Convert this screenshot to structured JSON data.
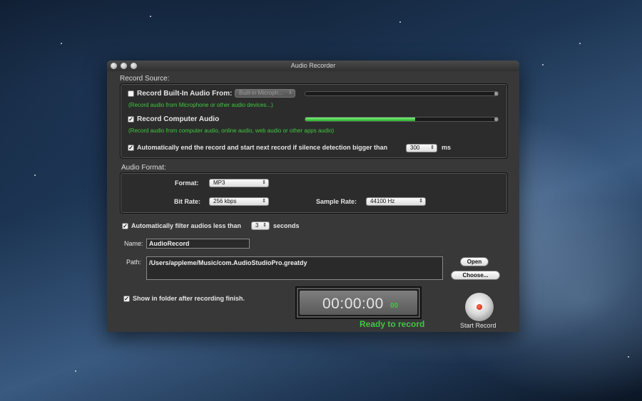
{
  "window": {
    "title": "Audio Recorder"
  },
  "record_source": {
    "label": "Record Source:",
    "builtin": {
      "checked": false,
      "label": "Record Built-In Audio From:",
      "device": "Built-in Microph...",
      "hint": "(Record audio from Microphone or other audio devices...)",
      "level": 0.0
    },
    "computer": {
      "checked": true,
      "label": "Record Computer Audio",
      "hint": "(Record audio from computer audio, online audio, web audio or other apps audio)",
      "level": 0.57
    },
    "silence": {
      "checked": true,
      "label": "Automatically end the record and start next record if silence detection bigger than",
      "value": "300",
      "unit": "ms"
    }
  },
  "audio_format": {
    "label": "Audio Format:",
    "format_label": "Format:",
    "format_value": "MP3",
    "bitrate_label": "Bit Rate:",
    "bitrate_value": "256 kbps",
    "samplerate_label": "Sample Rate:",
    "samplerate_value": "44100 Hz"
  },
  "filter": {
    "checked": true,
    "label": "Automatically filter audios less than",
    "value": "3",
    "unit": "seconds"
  },
  "name": {
    "label": "Name:",
    "value": "AudioRecord"
  },
  "path": {
    "label": "Path:",
    "value": "/Users/appleme/Music/com.AudioStudioPro.greatdy",
    "open_label": "Open",
    "choose_label": "Choose..."
  },
  "show_folder": {
    "checked": true,
    "label": "Show in folder after recording finish."
  },
  "timer": {
    "time": "00:00:00",
    "ms": "00",
    "status": "Ready to record"
  },
  "record_button": {
    "label": "Start Record"
  },
  "colors": {
    "accent_green": "#3ec83e",
    "window_bg": "#383838"
  }
}
